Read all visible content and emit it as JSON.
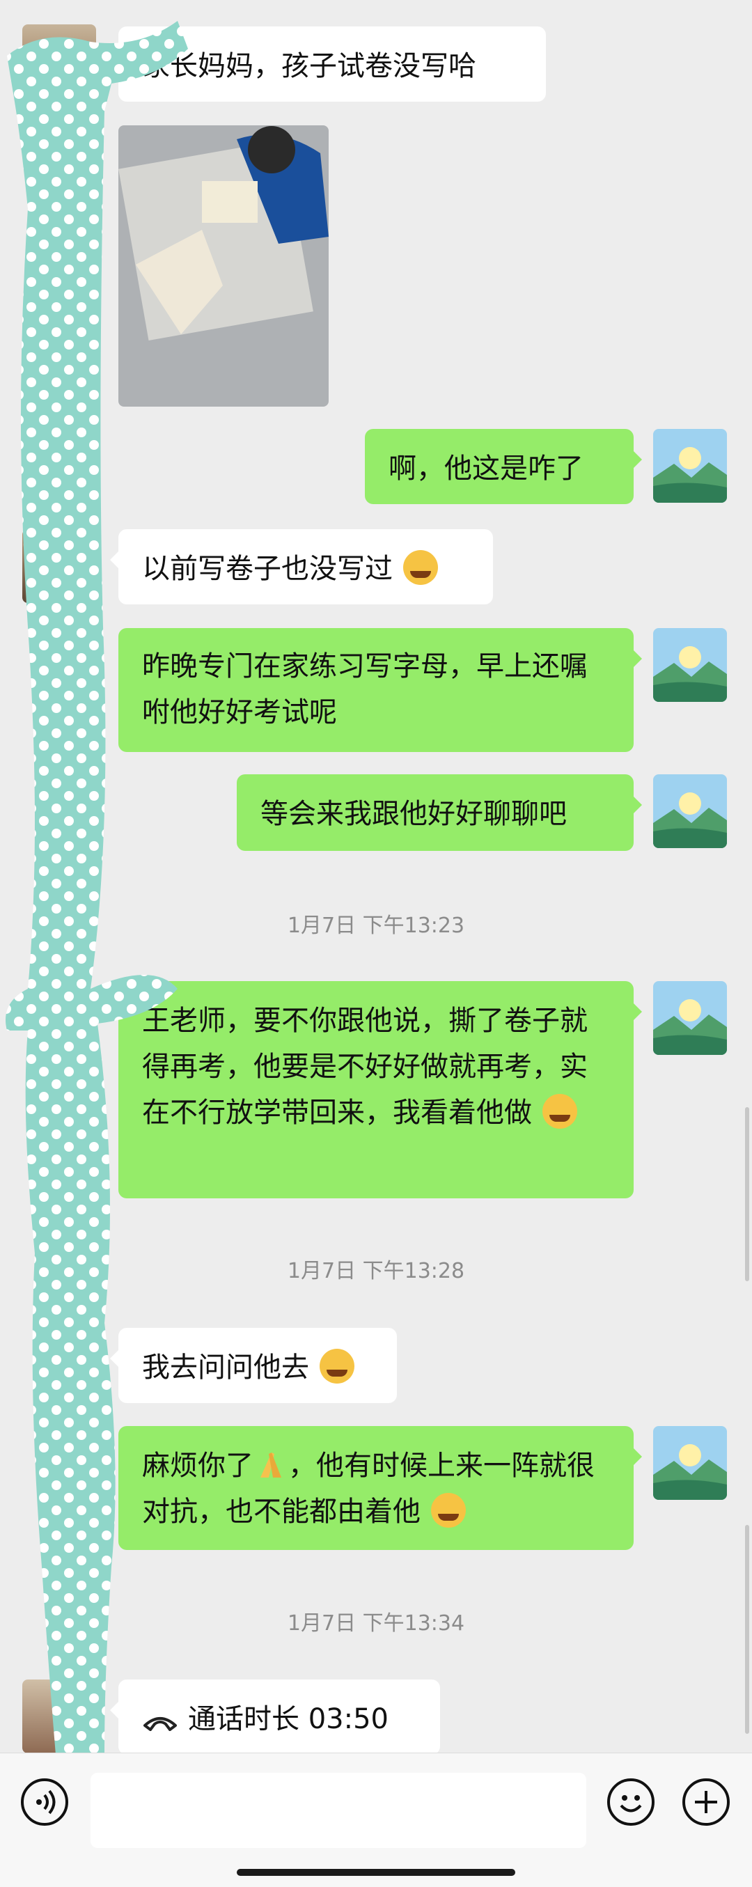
{
  "messages": {
    "m1": "家长妈妈，孩子试卷没写哈",
    "m2": "啊，他这是咋了",
    "m3": "以前写卷子也没写过",
    "m4": "昨晚专门在家练习写字母，早上还嘱咐他好好考试呢",
    "m5": "等会来我跟他好好聊聊吧",
    "m6": "王老师，要不你跟他说，撕了卷子就得再考，他要是不好好做就再考，实在不行放学带回来，我看着他做",
    "m7": "我去问问他去",
    "m8a": "麻烦你了",
    "m8b": "，他有时候上来一阵就很对抗，也不能都由着他",
    "call": "通话时长 03:50"
  },
  "times": {
    "t1": "1月7日 下午13:23",
    "t2": "1月7日 下午13:28",
    "t3": "1月7日 下午13:34"
  },
  "icons": {
    "voice": "voice-icon",
    "emoji": "emoji-face-icon",
    "plus": "plus-icon",
    "phone": "phone-icon"
  },
  "colors": {
    "background": "#ededed",
    "self_bubble": "#95ec69",
    "other_bubble": "#ffffff",
    "censor_overlay": "#8fd6c9"
  }
}
